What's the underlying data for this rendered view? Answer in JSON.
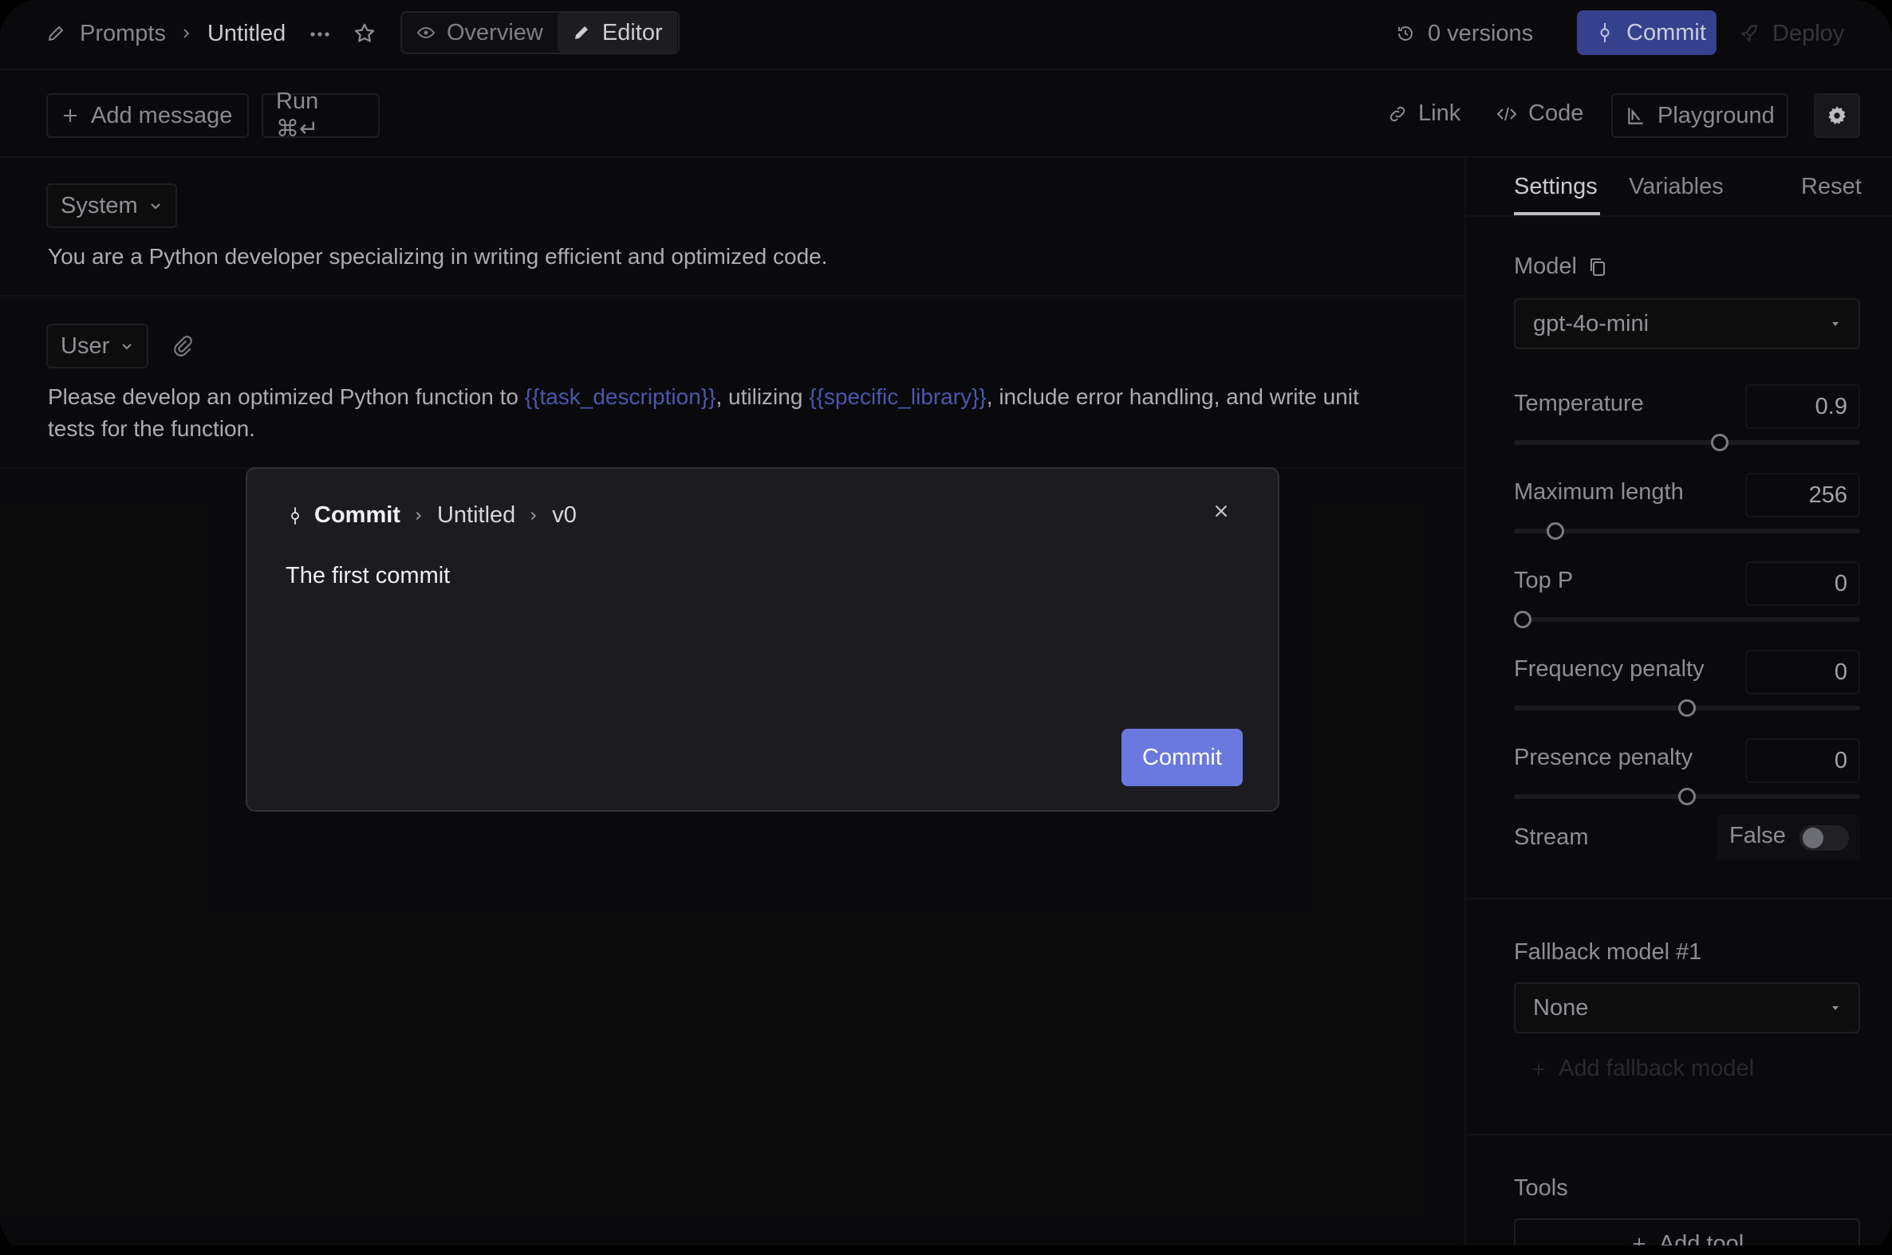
{
  "header": {
    "breadcrumb": [
      "Prompts",
      "Untitled"
    ],
    "more_icon": "ellipsis-icon",
    "star_icon": "star-icon",
    "tabs": [
      {
        "label": "Overview",
        "icon": "eye-icon",
        "active": false
      },
      {
        "label": "Editor",
        "icon": "pencil-icon",
        "active": true
      }
    ],
    "versions_label": "0 versions",
    "commit_label": "Commit",
    "deploy_label": "Deploy"
  },
  "toolbar": {
    "add_message_label": "Add message",
    "run_label": "Run ⌘↵",
    "link_label": "Link",
    "code_label": "Code",
    "playground_label": "Playground",
    "settings_icon": "gear-icon"
  },
  "messages": [
    {
      "role": "System",
      "text": "You are a Python developer specializing in writing efficient and optimized code."
    },
    {
      "role": "User",
      "attach_icon": "paperclip-icon",
      "text_parts": [
        "Please develop an optimized Python function to ",
        "{{task_description}}",
        ", utilizing ",
        "{{specific_library}}",
        ", include error handling, and write unit",
        "tests for the function."
      ]
    }
  ],
  "sidebar": {
    "tabs": [
      "Settings",
      "Variables"
    ],
    "active_tab": "Settings",
    "reset_label": "Reset",
    "model_label": "Model",
    "model_value": "gpt-4o-mini",
    "params": [
      {
        "label": "Temperature",
        "value": "0.9",
        "level": 0.6
      },
      {
        "label": "Maximum length",
        "value": "256",
        "level": 0.1
      },
      {
        "label": "Top P",
        "value": "0",
        "level": 0.0
      },
      {
        "label": "Frequency penalty",
        "value": "0",
        "level": 0.5
      },
      {
        "label": "Presence penalty",
        "value": "0",
        "level": 0.5
      }
    ],
    "stream_label": "Stream",
    "stream_value": "False",
    "fallback_label": "Fallback model #1",
    "fallback_value": "None",
    "add_fallback_label": "Add fallback model",
    "tools_label": "Tools",
    "add_tool_label": "Add tool"
  },
  "modal": {
    "crumbs": [
      "Commit",
      "Untitled",
      "v0"
    ],
    "message": "The first commit",
    "commit_button": "Commit",
    "close_icon": "close-icon"
  },
  "colors": {
    "accent": "#6a79e0",
    "accent_dark": "#3d4aa0",
    "variable": "#5563c4",
    "background": "#0c0c0e",
    "modal": "#1c1c20"
  }
}
